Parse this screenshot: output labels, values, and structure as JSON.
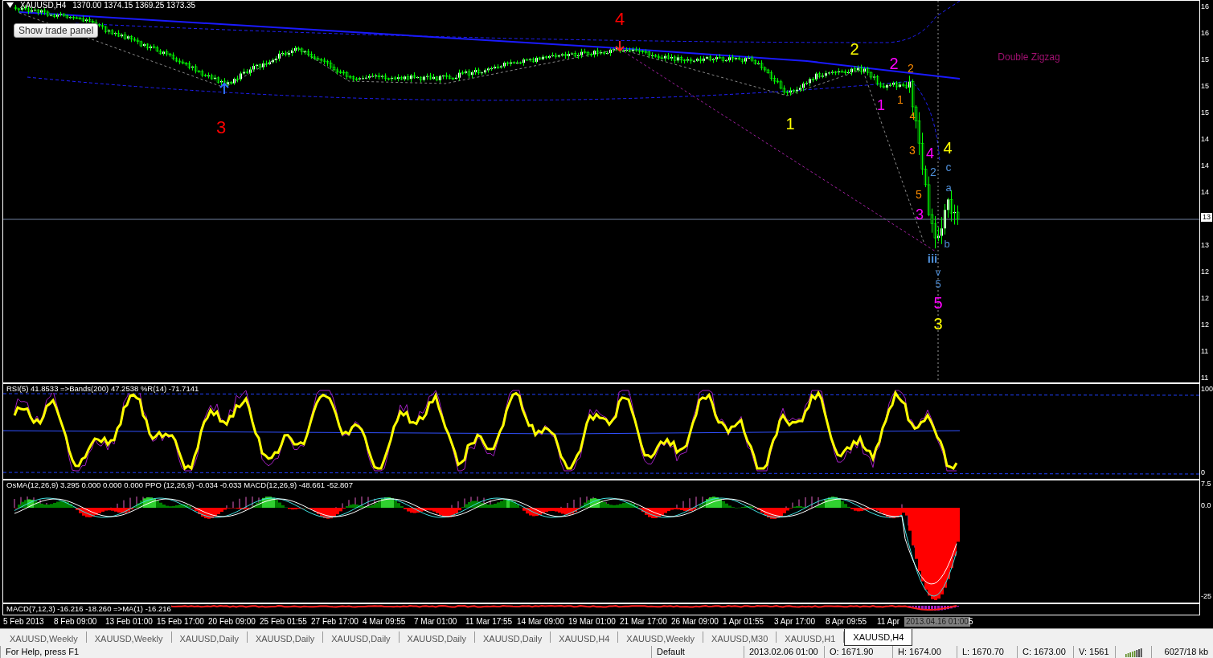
{
  "chart": {
    "symbol": "XAUUSD,H4",
    "ohlc": "1370.00 1374.15 1369.25 1373.35",
    "trade_panel_button": "Show trade panel",
    "wave_labels": [
      {
        "text": "4",
        "color": "#ff0000"
      },
      {
        "text": "3",
        "color": "#ff0000"
      },
      {
        "text": "2",
        "color": "#ffff00"
      },
      {
        "text": "2",
        "color": "#ff00ff"
      },
      {
        "text": "2",
        "color": "#ff8c00"
      },
      {
        "text": "1",
        "color": "#ff00ff"
      },
      {
        "text": "1",
        "color": "#ff8c00"
      },
      {
        "text": "1",
        "color": "#ffff00"
      },
      {
        "text": "4",
        "color": "#ff8c00"
      },
      {
        "text": "3",
        "color": "#ff8c00"
      },
      {
        "text": "4",
        "color": "#ff00ff"
      },
      {
        "text": "4",
        "color": "#ffff00"
      },
      {
        "text": "c",
        "color": "#4f8fd8"
      },
      {
        "text": "2",
        "color": "#4f8fd8"
      },
      {
        "text": "a",
        "color": "#4f8fd8"
      },
      {
        "text": "5",
        "color": "#ff8c00"
      },
      {
        "text": "3",
        "color": "#ff00ff"
      },
      {
        "text": "b",
        "color": "#4f8fd8"
      },
      {
        "text": "iii",
        "color": "#4f8fd8"
      },
      {
        "text": "v",
        "color": "#4f8fd8"
      },
      {
        "text": "5",
        "color": "#4f8fd8"
      },
      {
        "text": "5",
        "color": "#ff00ff"
      },
      {
        "text": "3",
        "color": "#ffff00"
      },
      {
        "text": "Double Zigzag",
        "color": "#a01070"
      }
    ],
    "price_axis": [
      {
        "text": "16",
        "kind": "tick"
      },
      {
        "text": "16",
        "kind": "tick"
      },
      {
        "text": "15",
        "kind": "tick"
      },
      {
        "text": "15",
        "kind": "tick"
      },
      {
        "text": "15",
        "kind": "tick"
      },
      {
        "text": "14",
        "kind": "tick"
      },
      {
        "text": "14",
        "kind": "tick"
      },
      {
        "text": "14",
        "kind": "tick"
      },
      {
        "text": "13",
        "kind": "cursor"
      },
      {
        "text": "13",
        "kind": "tick"
      },
      {
        "text": "12",
        "kind": "tick"
      },
      {
        "text": "12",
        "kind": "tick"
      },
      {
        "text": "12",
        "kind": "tick"
      },
      {
        "text": "11",
        "kind": "tick"
      },
      {
        "text": "11",
        "kind": "tick"
      }
    ]
  },
  "indicators": [
    {
      "kind": "rsi",
      "legend": "RSI(5) 41.8533  =>Bands(200) 47.2538  %R(14) -71.7141",
      "axis": [
        "100",
        "0"
      ]
    },
    {
      "kind": "osma",
      "legend": "OsMA(12,26,9) 3.295 0.000 0.000 0.000  PPO (12,26,9) -0.034 -0.033  MACD(12,26,9) -48.661 -52.807",
      "axis": [
        "7.5",
        "0.0",
        "-25"
      ]
    },
    {
      "kind": "macd",
      "legend": "MACD(7,12,3) -16.216 -18.260  =>MA(1) -16.216"
    }
  ],
  "time_axis": [
    {
      "text": "5 Feb 2013",
      "kind": "tick"
    },
    {
      "text": "8 Feb 09:00",
      "kind": "tick"
    },
    {
      "text": "13 Feb 01:00",
      "kind": "tick"
    },
    {
      "text": "15 Feb 17:00",
      "kind": "tick"
    },
    {
      "text": "20 Feb 09:00",
      "kind": "tick"
    },
    {
      "text": "25 Feb 01:55",
      "kind": "tick"
    },
    {
      "text": "27 Feb 17:00",
      "kind": "tick"
    },
    {
      "text": "4 Mar 09:55",
      "kind": "tick"
    },
    {
      "text": "7 Mar 01:00",
      "kind": "tick"
    },
    {
      "text": "11 Mar 17:55",
      "kind": "tick"
    },
    {
      "text": "14 Mar 09:00",
      "kind": "tick"
    },
    {
      "text": "19 Mar 01:00",
      "kind": "tick"
    },
    {
      "text": "21 Mar 17:00",
      "kind": "tick"
    },
    {
      "text": "26 Mar 09:00",
      "kind": "tick"
    },
    {
      "text": "1 Apr 01:55",
      "kind": "tick"
    },
    {
      "text": "3 Apr 17:00",
      "kind": "tick"
    },
    {
      "text": "8 Apr 09:55",
      "kind": "tick"
    },
    {
      "text": "11 Apr",
      "kind": "tick"
    },
    {
      "text": "2013.04.16 01:00",
      "kind": "cursor"
    },
    {
      "text": "5",
      "kind": "tick"
    }
  ],
  "tabs": [
    {
      "label": "XAUUSD,Weekly",
      "selected": false
    },
    {
      "label": "XAUUSD,Weekly",
      "selected": false
    },
    {
      "label": "XAUUSD,Daily",
      "selected": false
    },
    {
      "label": "XAUUSD,Daily",
      "selected": false
    },
    {
      "label": "XAUUSD,Daily",
      "selected": false
    },
    {
      "label": "XAUUSD,Daily",
      "selected": false
    },
    {
      "label": "XAUUSD,Daily",
      "selected": false
    },
    {
      "label": "XAUUSD,H4",
      "selected": false
    },
    {
      "label": "XAUUSD,Weekly",
      "selected": false
    },
    {
      "label": "XAUUSD,M30",
      "selected": false
    },
    {
      "label": "XAUUSD,H1",
      "selected": false
    },
    {
      "label": "XAUUSD,H4",
      "selected": true
    }
  ],
  "status_bar": [
    {
      "text": "For Help, press F1",
      "kind": "text"
    },
    {
      "text": "Default",
      "kind": "text"
    },
    {
      "text": "2013.02.06 01:00",
      "kind": "text"
    },
    {
      "text": "O: 1671.90",
      "kind": "text"
    },
    {
      "text": "H: 1674.00",
      "kind": "text"
    },
    {
      "text": "L: 1670.70",
      "kind": "text"
    },
    {
      "text": "C: 1673.00",
      "kind": "text"
    },
    {
      "text": "V: 1561",
      "kind": "text"
    },
    {
      "kind": "meter"
    },
    {
      "text": "6027/18 kb",
      "kind": "text"
    }
  ]
}
